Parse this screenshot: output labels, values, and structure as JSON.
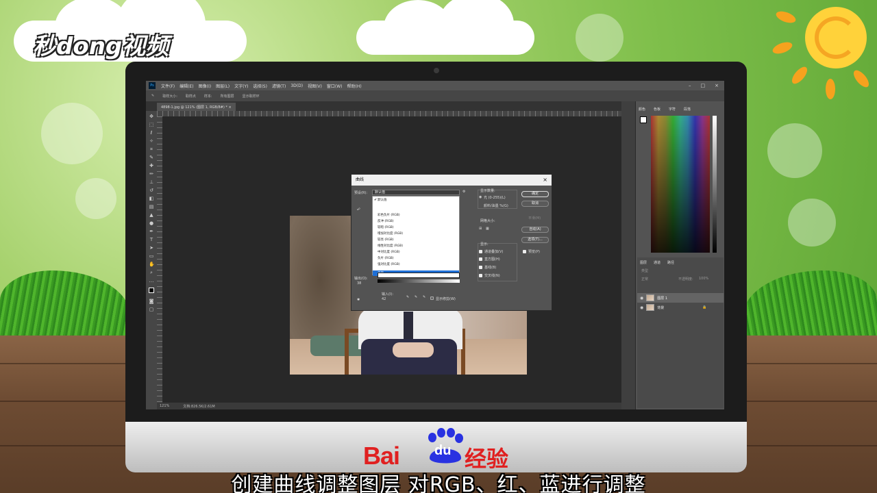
{
  "watermark": {
    "logo_text": "秒dong视频"
  },
  "photoshop": {
    "menu": [
      "文件(F)",
      "编辑(E)",
      "图像(I)",
      "图层(L)",
      "文字(Y)",
      "选择(S)",
      "滤镜(T)",
      "3D(D)",
      "视图(V)",
      "窗口(W)",
      "帮助(H)"
    ],
    "window_controls": [
      "–",
      "□",
      "×"
    ],
    "options_bar": {
      "sample_size_label": "取样大小:",
      "sample_size_value": "取样点",
      "sample_label": "样本:",
      "sample_value": "所有图层",
      "show_ring": "显示取样环"
    },
    "document_tab": "4898-1.jpg @ 121% (图层 1, RGB/8#) *  ×",
    "status": {
      "zoom": "121%",
      "doc": "文档:826.5K/2.61M"
    },
    "curves_dialog": {
      "title": "曲线",
      "preset_label": "预设(R):",
      "preset_value": "默认值",
      "preset_options": [
        "默认值",
        "彩色负片 (RGB)",
        "反冲 (RGB)",
        "较暗 (RGB)",
        "增加对比度 (RGB)",
        "较亮 (RGB)",
        "线性对比度 (RGB)",
        "中对比度 (RGB)",
        "负片 (RGB)",
        "强对比度 (RGB)"
      ],
      "preset_selected": "自定",
      "display_amount_label": "显示数量:",
      "light_option": "光 (0-255)(L)",
      "pigment_option": "颜料/油墨 %(G)",
      "grid_size_label": "网格大小:",
      "show_label": "显示:",
      "show_options": [
        "通道叠加(V)",
        "直方图(H)",
        "基线(B)",
        "交叉线(N)"
      ],
      "output_label": "输出(O):",
      "output_value": "38",
      "input_label": "输入(I):",
      "input_value": "42",
      "show_clipping": "显示修剪(W)",
      "buttons": {
        "ok": "确定",
        "cancel": "取消",
        "smooth": "平滑(M)",
        "auto": "自动(A)",
        "options": "选项(T)...",
        "preview": "预览(P)"
      }
    },
    "right_panels": {
      "color_tabs": [
        "颜色",
        "色板",
        "字符",
        "段落"
      ],
      "layers_tabs": [
        "图层",
        "通道",
        "路径"
      ],
      "layer_kind": "类型",
      "blend_mode": "正常",
      "opacity_label": "不透明度:",
      "opacity_value": "100%",
      "layers": [
        {
          "name": "图层 1"
        },
        {
          "name": "背景"
        }
      ]
    }
  },
  "baidu": {
    "bai": "Bai",
    "du": "du",
    "jingyan": "经验"
  },
  "subtitle": "创建曲线调整图层 对RGB、红、蓝进行调整"
}
